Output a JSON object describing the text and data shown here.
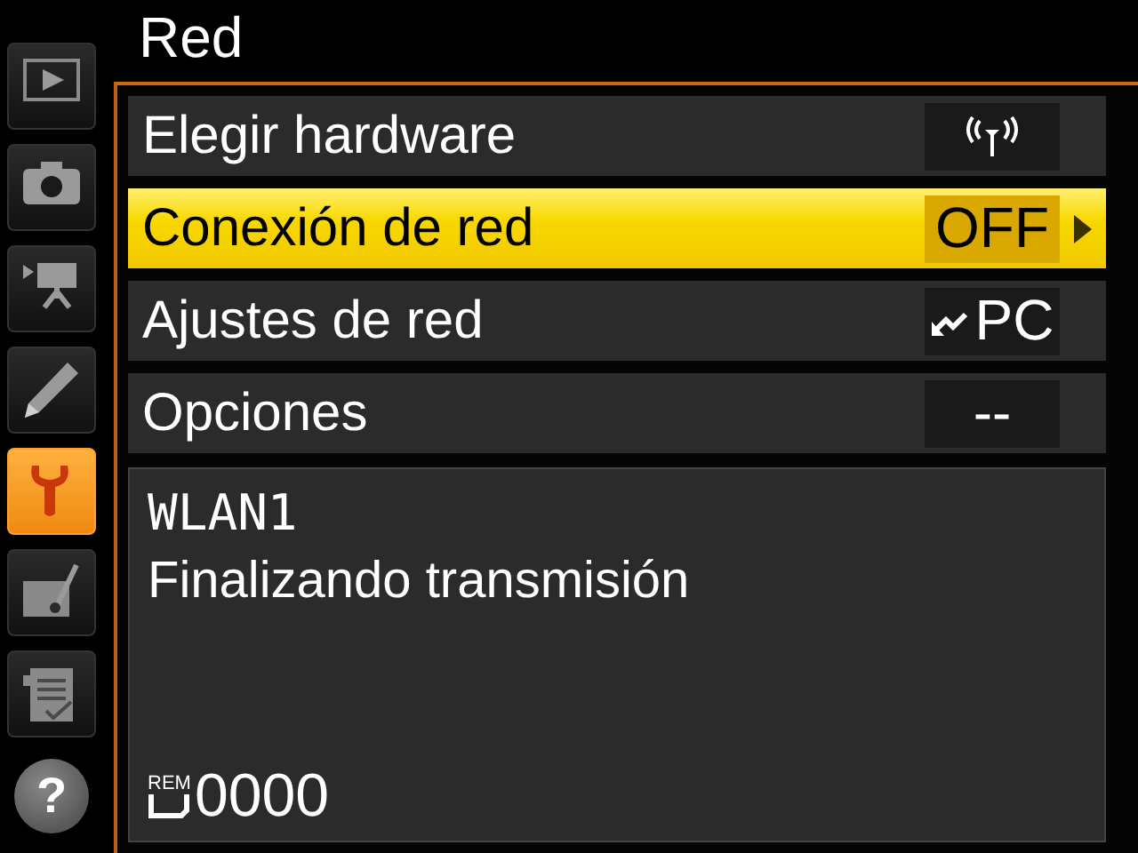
{
  "title": "Red",
  "sidebar": {
    "items": [
      {
        "kind": "playback",
        "selected": false
      },
      {
        "kind": "camera",
        "selected": false
      },
      {
        "kind": "movie",
        "selected": false
      },
      {
        "kind": "pencil",
        "selected": false
      },
      {
        "kind": "wrench",
        "selected": true
      },
      {
        "kind": "retouch",
        "selected": false
      },
      {
        "kind": "document",
        "selected": false
      },
      {
        "kind": "help",
        "label": "?",
        "selected": false
      }
    ]
  },
  "menu": [
    {
      "label": "Elegir hardware",
      "kind": "antenna",
      "selected": false
    },
    {
      "label": "Conexión de red",
      "kind": "text",
      "value": "OFF",
      "selected": true
    },
    {
      "label": "Ajustes de red",
      "kind": "link",
      "value": "PC",
      "selected": false
    },
    {
      "label": "Opciones",
      "kind": "text",
      "value": "--",
      "selected": false
    }
  ],
  "info": {
    "network": "WLAN1",
    "status": "Finalizando transmisión",
    "counter_label": "REM",
    "counter": "0000"
  }
}
